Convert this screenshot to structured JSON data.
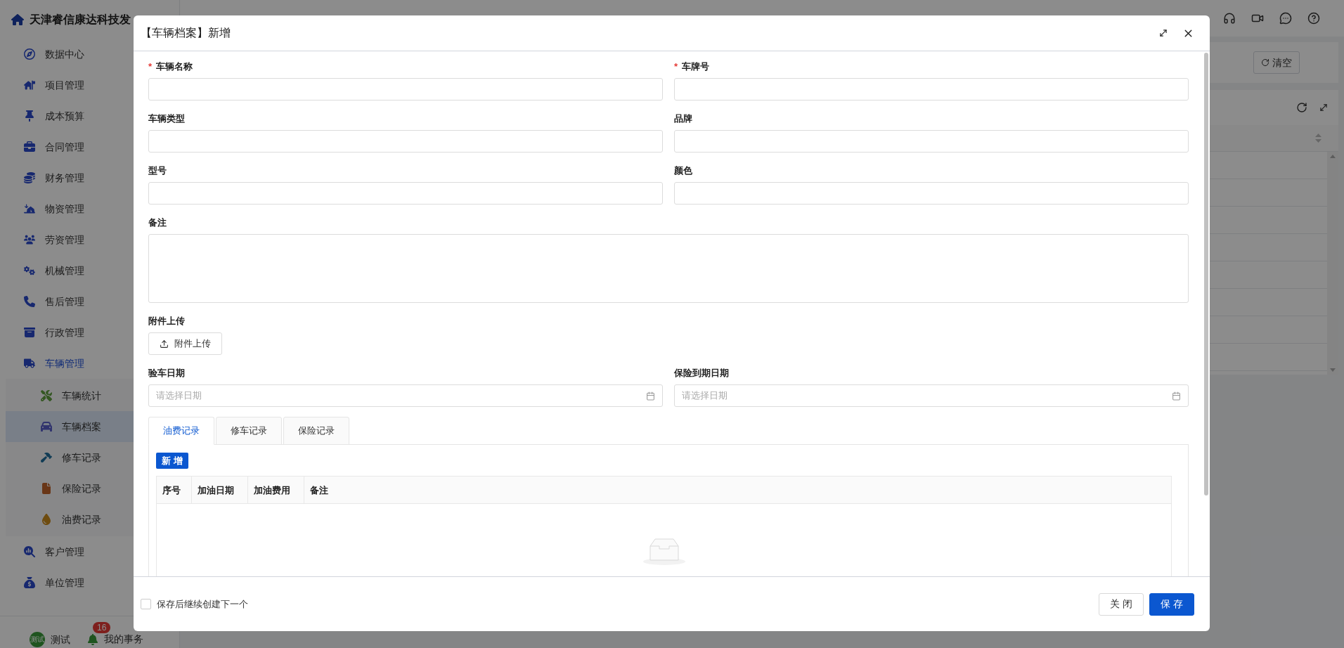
{
  "app": {
    "title": "天津睿信康达科技发"
  },
  "sidebar": {
    "items": [
      {
        "label": "数据中心",
        "active": false
      },
      {
        "label": "项目管理",
        "active": false
      },
      {
        "label": "成本预算",
        "active": false
      },
      {
        "label": "合同管理",
        "active": false
      },
      {
        "label": "财务管理",
        "active": false
      },
      {
        "label": "物资管理",
        "active": false
      },
      {
        "label": "劳资管理",
        "active": false
      },
      {
        "label": "机械管理",
        "active": false
      },
      {
        "label": "售后管理",
        "active": false
      },
      {
        "label": "行政管理",
        "active": false
      },
      {
        "label": "车辆管理",
        "active": true,
        "children": [
          {
            "label": "车辆统计",
            "selected": false
          },
          {
            "label": "车辆档案",
            "selected": true
          },
          {
            "label": "修车记录",
            "selected": false
          },
          {
            "label": "保险记录",
            "selected": false
          },
          {
            "label": "油费记录",
            "selected": false
          }
        ]
      },
      {
        "label": "客户管理",
        "active": false
      },
      {
        "label": "单位管理",
        "active": false
      }
    ],
    "user": {
      "name": "测试",
      "avatar_text": "测试"
    },
    "tasks": {
      "label": "我的事务",
      "badge": "16"
    }
  },
  "page": {
    "clear_button": "清空"
  },
  "dialog": {
    "title": "【车辆档案】新增",
    "fields": [
      {
        "label": "车辆名称",
        "marker": "*",
        "kind": "text"
      },
      {
        "label": "车牌号",
        "marker": "*",
        "kind": "text"
      },
      {
        "label": "车辆类型",
        "kind": "text"
      },
      {
        "label": "品牌",
        "kind": "text"
      },
      {
        "label": "型号",
        "kind": "text"
      },
      {
        "label": "颜色",
        "kind": "text"
      },
      {
        "label": "备注",
        "kind": "textarea"
      },
      {
        "label": "附件上传",
        "kind": "upload",
        "button": "附件上传"
      },
      {
        "label": "验车日期",
        "kind": "date",
        "placeholder": "请选择日期"
      },
      {
        "label": "保险到期日期",
        "kind": "date",
        "placeholder": "请选择日期"
      }
    ],
    "tabs": [
      {
        "label": "油费记录",
        "selected": true
      },
      {
        "label": "修车记录",
        "selected": false
      },
      {
        "label": "保险记录",
        "selected": false
      }
    ],
    "add_button": "新 增",
    "table": {
      "columns": [
        "序号",
        "加油日期",
        "加油费用",
        "备注"
      ]
    },
    "footer": {
      "checkbox": {
        "label": "保存后继续创建下一个",
        "checked": false
      },
      "buttons": [
        {
          "label": "关 闭",
          "kind": "default"
        },
        {
          "label": "保 存",
          "kind": "primary"
        }
      ]
    }
  }
}
